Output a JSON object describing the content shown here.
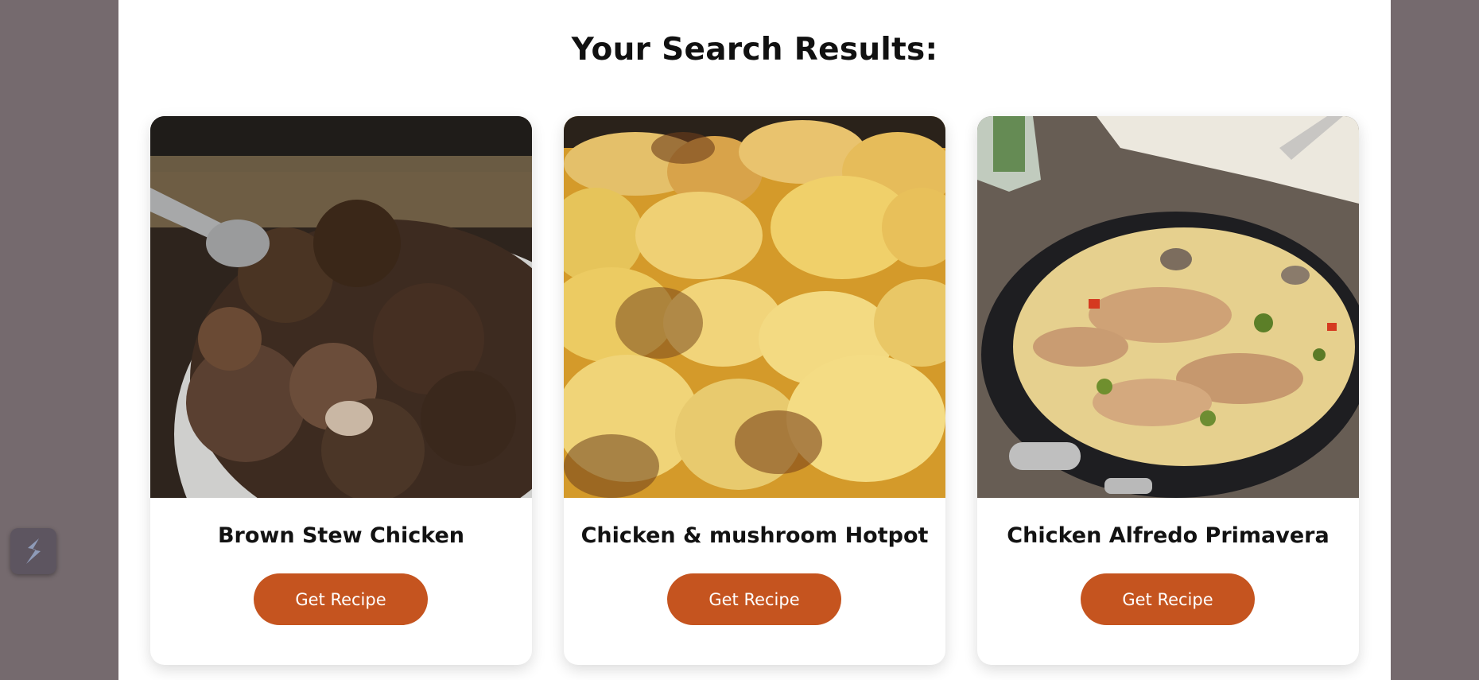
{
  "page": {
    "heading": "Your Search Results:"
  },
  "results": [
    {
      "title": "Brown Stew Chicken",
      "button_label": "Get Recipe"
    },
    {
      "title": "Chicken & mushroom Hotpot",
      "button_label": "Get Recipe"
    },
    {
      "title": "Chicken Alfredo Primavera",
      "button_label": "Get Recipe"
    }
  ],
  "colors": {
    "page_background": "#756a6e",
    "content_background": "#ffffff",
    "button_accent": "#c5541f"
  },
  "widget": {
    "icon": "s-logo-icon"
  }
}
